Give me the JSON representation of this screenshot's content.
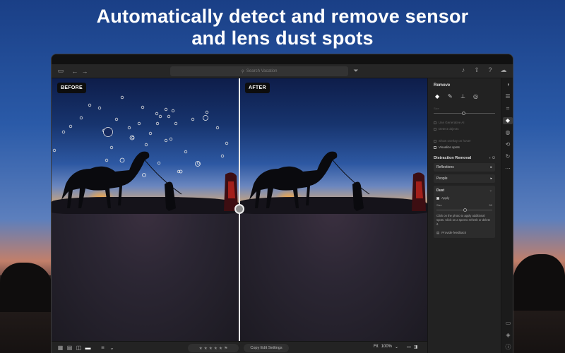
{
  "headline": {
    "line1": "Automatically detect and remove sensor",
    "line2": "and lens dust spots"
  },
  "toolbar": {
    "search_placeholder": "Search Vacation",
    "icons": [
      "sidebar-toggle-icon",
      "back-arrow-icon",
      "forward-arrow-icon",
      "search-icon",
      "filter-icon",
      "bell-icon",
      "share-icon",
      "help-icon",
      "cloud-icon"
    ]
  },
  "photo": {
    "before_label": "BEFORE",
    "after_label": "AFTER"
  },
  "filmstrip": {
    "copy_label": "Copy Edit Settings",
    "fit_label": "Fit",
    "zoom_label": "100%",
    "stars": "★ ★ ★ ★ ★"
  },
  "panel": {
    "title": "Remove",
    "size_label": "Size",
    "checks": [
      {
        "label": "Use Generative AI",
        "bright": false
      },
      {
        "label": "Detect objects",
        "bright": false
      },
      {
        "label": "Show overlay on hover",
        "bright": false
      },
      {
        "label": "Visualize spots",
        "bright": true
      }
    ],
    "distraction_title": "Distraction Removal",
    "reflections_label": "Reflections",
    "people_label": "People",
    "dust_label": "Dust",
    "apply_label": "Apply",
    "dust_size_label": "Size",
    "dust_size_value": "50",
    "hint": "Click on the photo to apply additional spots. Click on a spot to refresh or delete it.",
    "feedback_label": "Provide feedback"
  },
  "rail": {
    "icons": [
      "edit-icon",
      "sliders-icon",
      "crop-icon",
      "eraser-icon",
      "masking-icon",
      "history-icon",
      "refresh-icon",
      "more-icon"
    ],
    "bottom_icons": [
      "comment-icon",
      "tag-icon",
      "info-icon"
    ]
  }
}
